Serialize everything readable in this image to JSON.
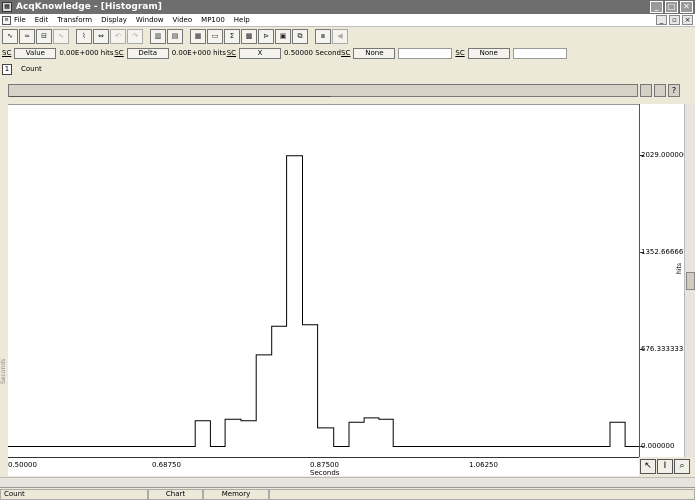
{
  "window": {
    "title": "AcqKnowledge - [Histogram]"
  },
  "menu": [
    "File",
    "Edit",
    "Transform",
    "Display",
    "Window",
    "Video",
    "MP100",
    "Help"
  ],
  "measurements": {
    "sc_label": "SC",
    "m1": {
      "type": "Value",
      "value": "0.00E+000 hits"
    },
    "m2": {
      "type": "Delta",
      "value": "0.00E+000 hits"
    },
    "m3": {
      "type": "X",
      "value": "0.50000 Second"
    },
    "m4": {
      "type": "None"
    },
    "m5": {
      "type": "None"
    }
  },
  "channel": {
    "number": "1",
    "label": "Count"
  },
  "side_buttons": {
    "help": "?"
  },
  "left_label": "Seconds",
  "y_axis": {
    "unit": "hits",
    "ticks": [
      "2029.000000",
      "1352.666667",
      "676.333333",
      "0.000000"
    ]
  },
  "x_axis": {
    "unit": "Seconds",
    "ticks": [
      "0.50000",
      "0.68750",
      "0.87500",
      "1.06250"
    ]
  },
  "status": {
    "left": "Count",
    "mid": "Chart",
    "right": "Memory"
  },
  "chart_data": {
    "type": "area",
    "title": "",
    "xlabel": "Seconds",
    "ylabel": "hits",
    "xlim": [
      0.5,
      1.25
    ],
    "ylim": [
      -80,
      2385
    ],
    "x": [
      0.5,
      0.7225,
      0.7406,
      0.758,
      0.7769,
      0.795,
      0.8134,
      0.8311,
      0.85,
      0.868,
      0.8871,
      0.9053,
      0.9232,
      0.9408,
      0.9578,
      0.9766,
      1.2155,
      1.2335,
      1.25
    ],
    "values": [
      0,
      180,
      0,
      190,
      180,
      640,
      840,
      2030,
      850,
      130,
      0,
      170,
      200,
      190,
      0,
      0,
      170,
      0,
      0
    ]
  }
}
